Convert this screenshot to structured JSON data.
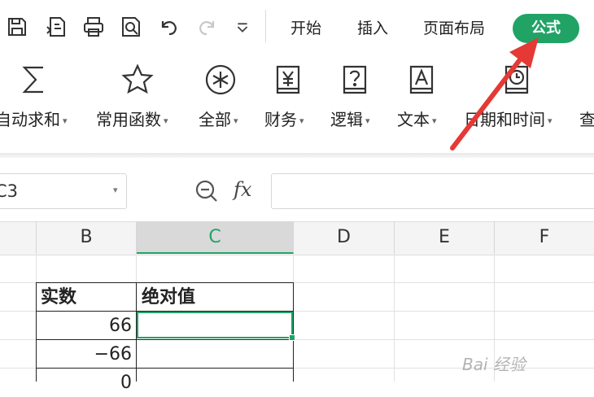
{
  "menu_tabs": [
    {
      "label": "开始"
    },
    {
      "label": "插入"
    },
    {
      "label": "页面布局"
    }
  ],
  "active_tab": {
    "label": "公式"
  },
  "quick_access_icons": [
    "save-icon",
    "export-icon",
    "print-icon",
    "print-preview-icon",
    "undo-icon",
    "redo-icon",
    "more-chevron-icon"
  ],
  "ribbon": {
    "items": [
      {
        "label": "自动求和",
        "icon": "sigma-icon"
      },
      {
        "label": "常用函数",
        "icon": "star-icon"
      },
      {
        "label": "全部",
        "icon": "asterisk-circle-icon"
      },
      {
        "label": "财务",
        "icon": "yen-book-icon"
      },
      {
        "label": "逻辑",
        "icon": "question-book-icon"
      },
      {
        "label": "文本",
        "icon": "text-a-book-icon"
      },
      {
        "label": "日期和时间",
        "icon": "clock-book-icon"
      },
      {
        "label": "查"
      }
    ]
  },
  "formula_bar": {
    "name_box": "C3",
    "fx_label": "fx",
    "value": ""
  },
  "columns": [
    "B",
    "C",
    "D",
    "E",
    "F"
  ],
  "active_column": "C",
  "table": {
    "header": {
      "b": "实数",
      "c": "绝对值"
    },
    "rows": [
      {
        "b": "66",
        "c": ""
      },
      {
        "b": "−66",
        "c": ""
      },
      {
        "b": "0",
        "c": ""
      }
    ]
  },
  "colors": {
    "accent": "#21a366",
    "arrow": "#e53935"
  },
  "watermark": "Bai 经验"
}
